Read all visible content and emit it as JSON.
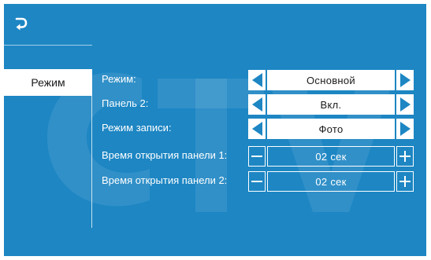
{
  "colors": {
    "background": "#1d86c3",
    "panel_white": "#ffffff",
    "text_dark": "#1a1a1a"
  },
  "header": {
    "back_icon": "return-arrow-icon"
  },
  "sidebar": {
    "items": [
      {
        "label": "Режим",
        "selected": true
      }
    ]
  },
  "settings": [
    {
      "label": "Режим:",
      "value": "Основной",
      "control": "arrows"
    },
    {
      "label": "Панель 2:",
      "value": "Вкл.",
      "control": "arrows"
    },
    {
      "label": "Режим записи:",
      "value": "Фото",
      "control": "arrows"
    },
    {
      "label": "Время открытия панели 1:",
      "value": "02 сек",
      "control": "stepper"
    },
    {
      "label": "Время открытия панели 2:",
      "value": "02 сек",
      "control": "stepper"
    }
  ]
}
